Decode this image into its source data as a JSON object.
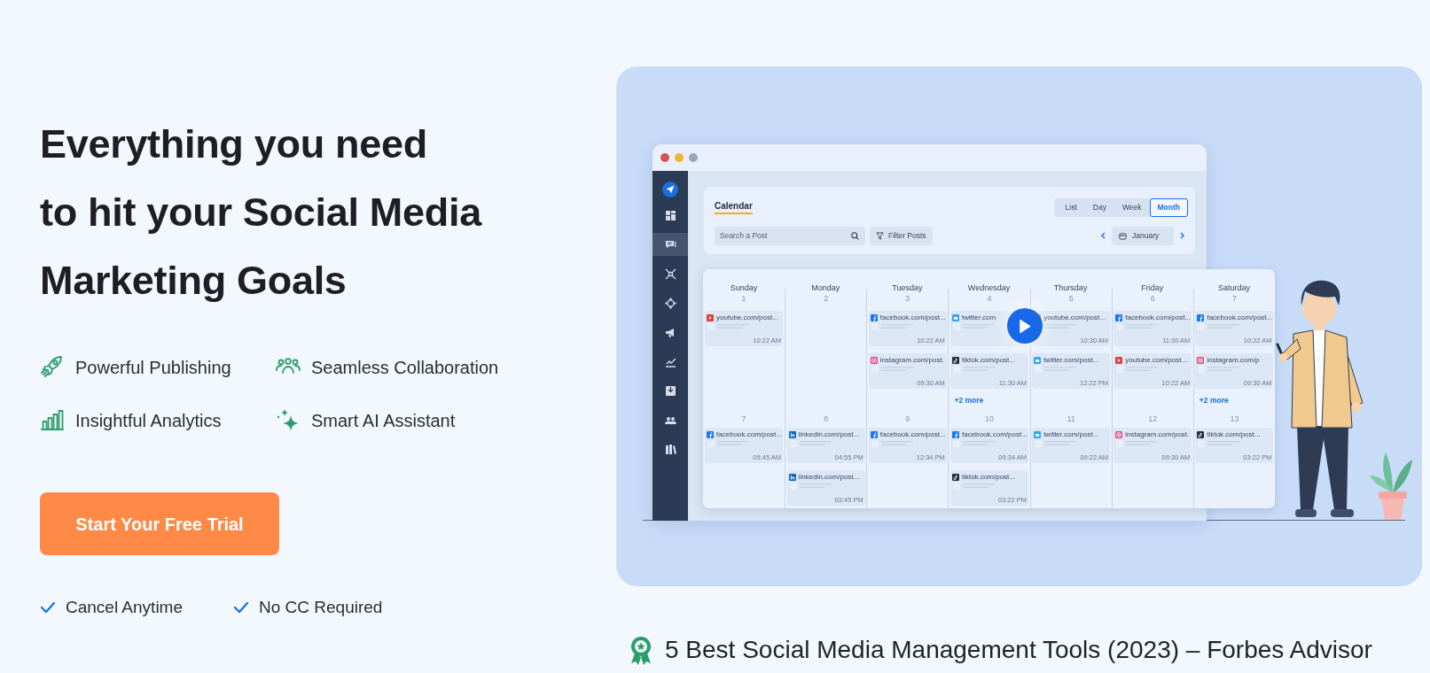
{
  "headline_lines": [
    "Everything you need",
    "to hit your Social Media",
    "Marketing Goals"
  ],
  "features": [
    "Powerful Publishing",
    "Seamless Collaboration",
    "Insightful Analytics",
    "Smart AI Assistant"
  ],
  "cta": "Start Your Free Trial",
  "perks": [
    "Cancel Anytime",
    "No CC Required"
  ],
  "video": {
    "app": {
      "sidebar": [
        {
          "selected": false
        },
        {
          "selected": true
        },
        {
          "selected": false
        },
        {
          "selected": false
        },
        {
          "selected": false
        },
        {
          "selected": false
        },
        {
          "selected": false
        },
        {
          "selected": false
        },
        {
          "selected": false
        }
      ],
      "calendar": {
        "title": "Calendar",
        "views": [
          {
            "label": "List",
            "selected": false
          },
          {
            "label": "Day",
            "selected": false
          },
          {
            "label": "Week",
            "selected": false
          },
          {
            "label": "Month",
            "selected": true
          }
        ],
        "search_placeholder": "Search a Post",
        "filter": "Filter Posts",
        "month": "January",
        "days": [
          "Sunday",
          "Monday",
          "Tuesday",
          "Wednesday",
          "Thursday",
          "Friday",
          "Saturday"
        ],
        "weeks": [
          [
            {
              "date": "1",
              "posts": [
                {
                  "kind": "youtube",
                  "url": "youtube.com/post...",
                  "time": "10:22 AM"
                }
              ]
            },
            {
              "date": "2"
            },
            {
              "date": "3",
              "posts": [
                {
                  "kind": "facebook",
                  "url": "facebook.com/post...",
                  "time": "10:22 AM"
                },
                {
                  "kind": "instagram",
                  "url": "instagram.com/post.",
                  "time": "09:30 AM"
                }
              ]
            },
            {
              "date": "4",
              "posts": [
                {
                  "kind": "twitter",
                  "url": "twitter.com"
                },
                {
                  "kind": "tiktok",
                  "url": "tiktok.com/post...",
                  "time": "11:30 AM"
                }
              ],
              "more": "+2 more"
            },
            {
              "date": "5",
              "posts": [
                {
                  "kind": "youtube",
                  "url": "youtube.com/post...",
                  "time": "10:30 AM"
                },
                {
                  "kind": "twitter",
                  "url": "twitter.com/post...",
                  "time": "12:22 PM"
                }
              ]
            },
            {
              "date": "6",
              "posts": [
                {
                  "kind": "facebook",
                  "url": "facebook.com/post...",
                  "time": "11:30 AM"
                },
                {
                  "kind": "youtube",
                  "url": "youtube.com/post...",
                  "time": "10:22 AM"
                }
              ]
            },
            {
              "date": "7",
              "posts": [
                {
                  "kind": "facebook",
                  "url": "facebook.com/post...",
                  "time": "10:22 AM"
                },
                {
                  "kind": "instagram",
                  "url": "instagram.com/p",
                  "time": "09:30 AM"
                }
              ],
              "more": "+2 more"
            }
          ],
          [
            {
              "date": "7",
              "posts": [
                {
                  "kind": "facebook",
                  "url": "facebook.com/post...",
                  "time": "05:45 AM"
                }
              ]
            },
            {
              "date": "8",
              "posts": [
                {
                  "kind": "linkedin",
                  "url": "linkedin.com/post...",
                  "time": "04:55 PM"
                },
                {
                  "kind": "linkedin",
                  "url": "linkedin.com/post...",
                  "time": "03:45 PM"
                }
              ]
            },
            {
              "date": "9",
              "posts": [
                {
                  "kind": "facebook",
                  "url": "facebook.com/post...",
                  "time": "12:34 PM"
                }
              ]
            },
            {
              "date": "10",
              "posts": [
                {
                  "kind": "facebook",
                  "url": "facebook.com/post...",
                  "time": "09:34 AM"
                },
                {
                  "kind": "tiktok",
                  "url": "tiktok.com/post...",
                  "time": "03:22 PM"
                }
              ]
            },
            {
              "date": "11",
              "posts": [
                {
                  "kind": "twitter",
                  "url": "twitter.com/post...",
                  "time": "09:22 AM"
                }
              ]
            },
            {
              "date": "12",
              "posts": [
                {
                  "kind": "instagram",
                  "url": "instagram.com/post.",
                  "time": "09:30 AM"
                }
              ]
            },
            {
              "date": "13",
              "posts": [
                {
                  "kind": "tiktok",
                  "url": "tiktok.com/post...",
                  "time": "03:22 PM"
                }
              ]
            }
          ]
        ]
      }
    }
  },
  "award": "5 Best Social Media Management Tools (2023) – Forbes Advisor"
}
